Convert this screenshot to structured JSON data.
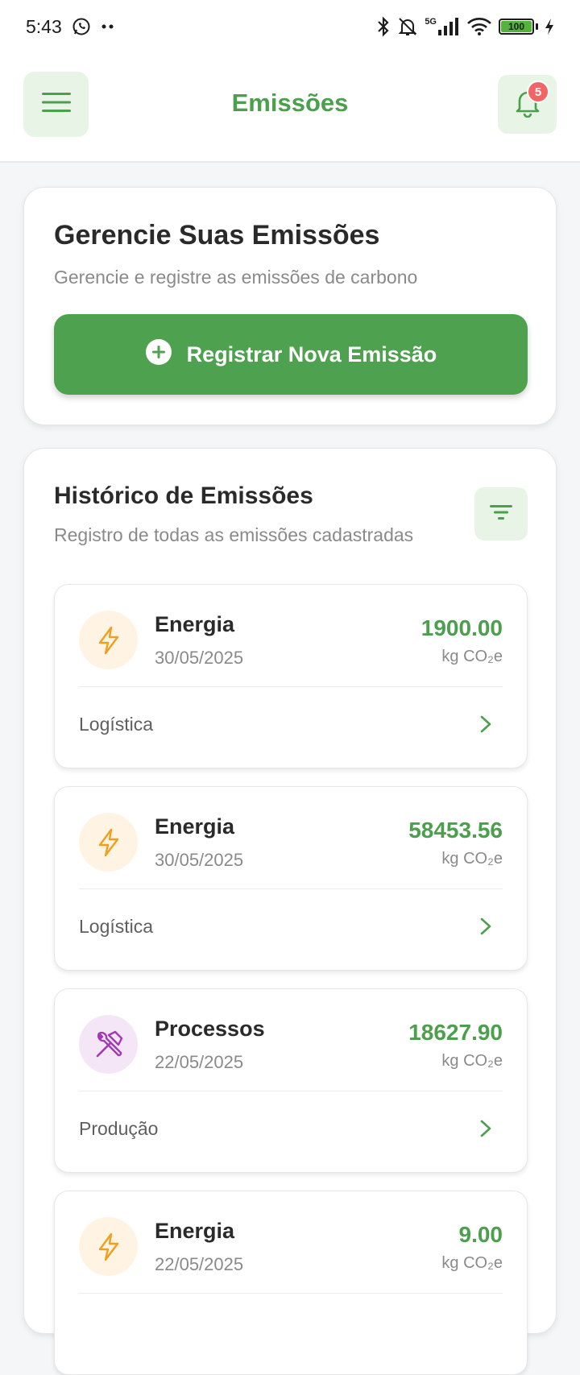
{
  "status_bar": {
    "time": "5:43",
    "network": "5G",
    "battery": "100"
  },
  "header": {
    "title": "Emissões",
    "notification_count": "5"
  },
  "manage": {
    "title": "Gerencie Suas Emissões",
    "subtitle": "Gerencie e registre as emissões de carbono",
    "register_button": "Registrar Nova Emissão"
  },
  "history": {
    "title": "Histórico de Emissões",
    "subtitle": "Registro de todas as emissões cadastradas",
    "entries": [
      {
        "type": "Energia",
        "date": "30/05/2025",
        "value": "1900.00",
        "unit": "kg CO₂e",
        "department": "Logística",
        "icon": "lightning-icon"
      },
      {
        "type": "Energia",
        "date": "30/05/2025",
        "value": "58453.56",
        "unit": "kg CO₂e",
        "department": "Logística",
        "icon": "lightning-icon"
      },
      {
        "type": "Processos",
        "date": "22/05/2025",
        "value": "18627.90",
        "unit": "kg CO₂e",
        "department": "Produção",
        "icon": "tools-icon"
      },
      {
        "type": "Energia",
        "date": "22/05/2025",
        "value": "9.00",
        "unit": "kg CO₂e",
        "department": "",
        "icon": "lightning-icon"
      }
    ]
  },
  "colors": {
    "brand_green": "#4b9f4d",
    "button_green": "#4ea24f",
    "light_green_bg": "#e8f4e6",
    "energy_icon": "#f0a020",
    "energy_bg": "#fff3e3",
    "process_icon": "#a03cb0",
    "process_bg": "#f5e6f7",
    "badge_red": "#f16565"
  }
}
